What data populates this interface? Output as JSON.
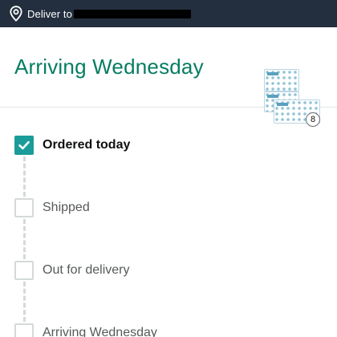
{
  "topbar": {
    "deliver_label": "Deliver to",
    "background": "#232f3e"
  },
  "header": {
    "title": "Arriving Wednesday",
    "title_color": "#067d62",
    "product_quantity": "8"
  },
  "steps": [
    {
      "label": "Ordered today",
      "completed": true
    },
    {
      "label": "Shipped",
      "completed": false
    },
    {
      "label": "Out for delivery",
      "completed": false
    },
    {
      "label": "Arriving Wednesday",
      "completed": false
    }
  ],
  "colors": {
    "check_accent": "#1a9c9a",
    "inactive_text": "#565959",
    "active_text": "#0f1111",
    "connector": "#d5d9d9"
  },
  "icons": {
    "location": "location-pin-icon",
    "check": "checkmark-icon"
  }
}
